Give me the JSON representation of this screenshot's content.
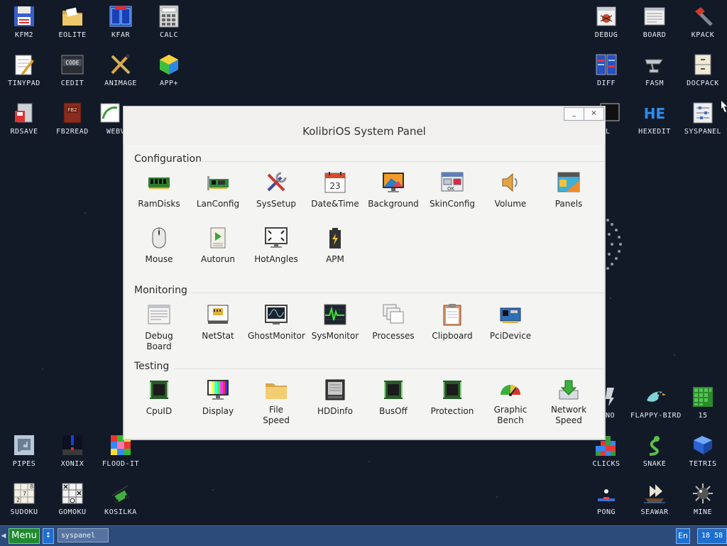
{
  "desktop": {
    "left_icons": [
      {
        "label": "KFM2",
        "icon": "floppy-icon"
      },
      {
        "label": "EOLITE",
        "icon": "folder-icon"
      },
      {
        "label": "KFAR",
        "icon": "dual-panel-icon"
      },
      {
        "label": "CALC",
        "icon": "calculator-icon"
      },
      {
        "label": "TINYPAD",
        "icon": "notepad-icon"
      },
      {
        "label": "CEDIT",
        "icon": "code-editor-icon"
      },
      {
        "label": "ANIMAGE",
        "icon": "paint-tools-icon"
      },
      {
        "label": "APP+",
        "icon": "cube-icon"
      },
      {
        "label": "RDSAVE",
        "icon": "ramdisk-save-icon"
      },
      {
        "label": "FB2READ",
        "icon": "book-icon"
      },
      {
        "label": "WEBV",
        "icon": "browser-icon"
      }
    ],
    "right_icons": [
      {
        "label": "DEBUG",
        "icon": "bug-icon"
      },
      {
        "label": "BOARD",
        "icon": "board-icon"
      },
      {
        "label": "KPACK",
        "icon": "hammer-icon"
      },
      {
        "label": "DIFF",
        "icon": "diff-icon"
      },
      {
        "label": "FASM",
        "icon": "anvil-icon"
      },
      {
        "label": "DOCPACK",
        "icon": "cabinet-icon"
      },
      {
        "label": "ELL",
        "icon": "shell-icon"
      },
      {
        "label": "HEXEDIT",
        "icon": "hex-icon"
      },
      {
        "label": "SYSPANEL",
        "icon": "sliders-icon"
      }
    ],
    "bottom_left_icons": [
      {
        "label": "PIPES",
        "icon": "pipes-icon"
      },
      {
        "label": "XONIX",
        "icon": "xonix-icon"
      },
      {
        "label": "FLOOD-IT",
        "icon": "flood-icon"
      },
      {
        "label": "SUDOKU",
        "icon": "sudoku-icon"
      },
      {
        "label": "GOMOKU",
        "icon": "gomoku-icon"
      },
      {
        "label": "KOSILKA",
        "icon": "lawnmower-icon"
      }
    ],
    "bottom_right_icons": [
      {
        "label": "NO",
        "icon": "piano-icon"
      },
      {
        "label": "FLAPPY-BIRD",
        "icon": "bird-icon"
      },
      {
        "label": "15",
        "icon": "fifteen-icon"
      },
      {
        "label": "CLICKS",
        "icon": "clicks-icon"
      },
      {
        "label": "SNAKE",
        "icon": "snake-icon"
      },
      {
        "label": "TETRIS",
        "icon": "tetris-icon"
      },
      {
        "label": "PONG",
        "icon": "pong-icon"
      },
      {
        "label": "SEAWAR",
        "icon": "ship-icon"
      },
      {
        "label": "MINE",
        "icon": "mine-icon"
      }
    ]
  },
  "window": {
    "title": "KolibriOS System Panel",
    "min_label": "_",
    "close_label": "×",
    "sections": [
      {
        "title": "Configuration",
        "items": [
          {
            "label": "RamDisks",
            "icon": "ram-icon"
          },
          {
            "label": "LanConfig",
            "icon": "network-card-icon"
          },
          {
            "label": "SysSetup",
            "icon": "tools-icon"
          },
          {
            "label": "Date&Time",
            "icon": "calendar-icon",
            "day": "23"
          },
          {
            "label": "Background",
            "icon": "monitor-wallpaper-icon"
          },
          {
            "label": "SkinConfig",
            "icon": "skin-icon"
          },
          {
            "label": "Volume",
            "icon": "speaker-icon"
          },
          {
            "label": "Panels",
            "icon": "panels-icon"
          },
          {
            "label": "Mouse",
            "icon": "mouse-icon"
          },
          {
            "label": "Autorun",
            "icon": "scroll-play-icon"
          },
          {
            "label": "HotAngles",
            "icon": "hot-angles-icon"
          },
          {
            "label": "APM",
            "icon": "battery-icon"
          }
        ]
      },
      {
        "title": "Monitoring",
        "items": [
          {
            "label": "Debug Board",
            "icon": "debug-board-icon"
          },
          {
            "label": "NetStat",
            "icon": "netstat-icon"
          },
          {
            "label": "GhostMonitor",
            "icon": "ghost-monitor-icon"
          },
          {
            "label": "SysMonitor",
            "icon": "sysmonitor-icon"
          },
          {
            "label": "Processes",
            "icon": "processes-icon"
          },
          {
            "label": "Clipboard",
            "icon": "clipboard-icon"
          },
          {
            "label": "PciDevice",
            "icon": "pci-card-icon"
          }
        ]
      },
      {
        "title": "Testing",
        "items": [
          {
            "label": "CpuID",
            "icon": "chip-icon"
          },
          {
            "label": "Display",
            "icon": "display-test-icon"
          },
          {
            "label": "File Speed",
            "icon": "folder-speed-icon"
          },
          {
            "label": "HDDinfo",
            "icon": "hdd-icon"
          },
          {
            "label": "BusOff",
            "icon": "chip-busoff-icon"
          },
          {
            "label": "Protection",
            "icon": "chip-protection-icon"
          },
          {
            "label": "Graphic Bench",
            "icon": "gauge-icon"
          },
          {
            "label": "Network Speed",
            "icon": "download-icon"
          }
        ]
      }
    ]
  },
  "taskbar": {
    "menu_label": "Menu",
    "switch_label": "↕",
    "task_label": "syspanel",
    "lang": "En",
    "clock": "18 58"
  }
}
